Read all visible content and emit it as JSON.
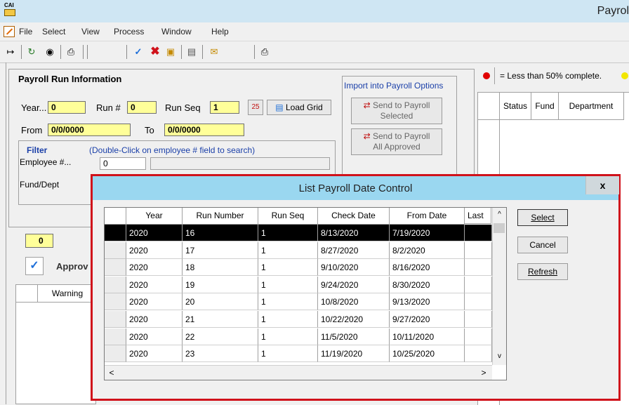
{
  "app": {
    "icon_text": "CAI",
    "title": "Payrol"
  },
  "menu": [
    "File",
    "Select",
    "View",
    "Process",
    "Window",
    "Help"
  ],
  "toolbar_icons": [
    "exit-icon",
    "refresh-icon",
    "binoculars-icon",
    "print-icon",
    "check-icon",
    "delete-icon",
    "save-icon",
    "report-icon",
    "mail-icon",
    "print-setup-icon"
  ],
  "payroll_run": {
    "title": "Payroll Run Information",
    "year_label": "Year...",
    "year_value": "0",
    "run_label": "Run #",
    "run_value": "0",
    "runseq_label": "Run Seq",
    "runseq_value": "1",
    "load_grid": "Load Grid",
    "from_label": "From",
    "from_value": "0/0/0000",
    "to_label": "To",
    "to_value": "0/0/0000",
    "filter_label": "Filter",
    "filter_hint": "(Double-Click on employee # field to search)",
    "employee_label": "Employee #...",
    "employee_value": "0",
    "funddept_label": "Fund/Dept"
  },
  "import_options": {
    "title": "Import into Payroll Options",
    "send_selected_line1": "Send to Payroll",
    "send_selected_line2": "Selected",
    "send_approved_line1": "Send to Payroll",
    "send_approved_line2": "All Approved"
  },
  "lower_left": {
    "count_value": "0",
    "approve_label": "Approv",
    "warning_header": "Warning"
  },
  "legend": {
    "text": "= Less than 50% complete.",
    "color_red": "#e00000",
    "color_yellow": "#f2e600"
  },
  "right_grid": {
    "headers": [
      "Status",
      "Fund",
      "Department"
    ]
  },
  "dialog": {
    "title": "List Payroll Date Control",
    "close": "x",
    "headers": [
      "Year",
      "Run Number",
      "Run Seq",
      "Check Date",
      "From Date",
      "Last"
    ],
    "rows": [
      [
        "2020",
        "16",
        "1",
        "8/13/2020",
        "7/19/2020",
        ""
      ],
      [
        "2020",
        "17",
        "1",
        "8/27/2020",
        "8/2/2020",
        ""
      ],
      [
        "2020",
        "18",
        "1",
        "9/10/2020",
        "8/16/2020",
        ""
      ],
      [
        "2020",
        "19",
        "1",
        "9/24/2020",
        "8/30/2020",
        ""
      ],
      [
        "2020",
        "20",
        "1",
        "10/8/2020",
        "9/13/2020",
        ""
      ],
      [
        "2020",
        "21",
        "1",
        "10/22/2020",
        "9/27/2020",
        ""
      ],
      [
        "2020",
        "22",
        "1",
        "11/5/2020",
        "10/11/2020",
        ""
      ],
      [
        "2020",
        "23",
        "1",
        "11/19/2020",
        "10/25/2020",
        ""
      ]
    ],
    "selected_row": 0,
    "select_button": "Select",
    "cancel_button": "Cancel",
    "refresh_button": "Refresh",
    "scroll_up": "^",
    "scroll_down": "v",
    "scroll_left": "<",
    "scroll_right": ">"
  }
}
